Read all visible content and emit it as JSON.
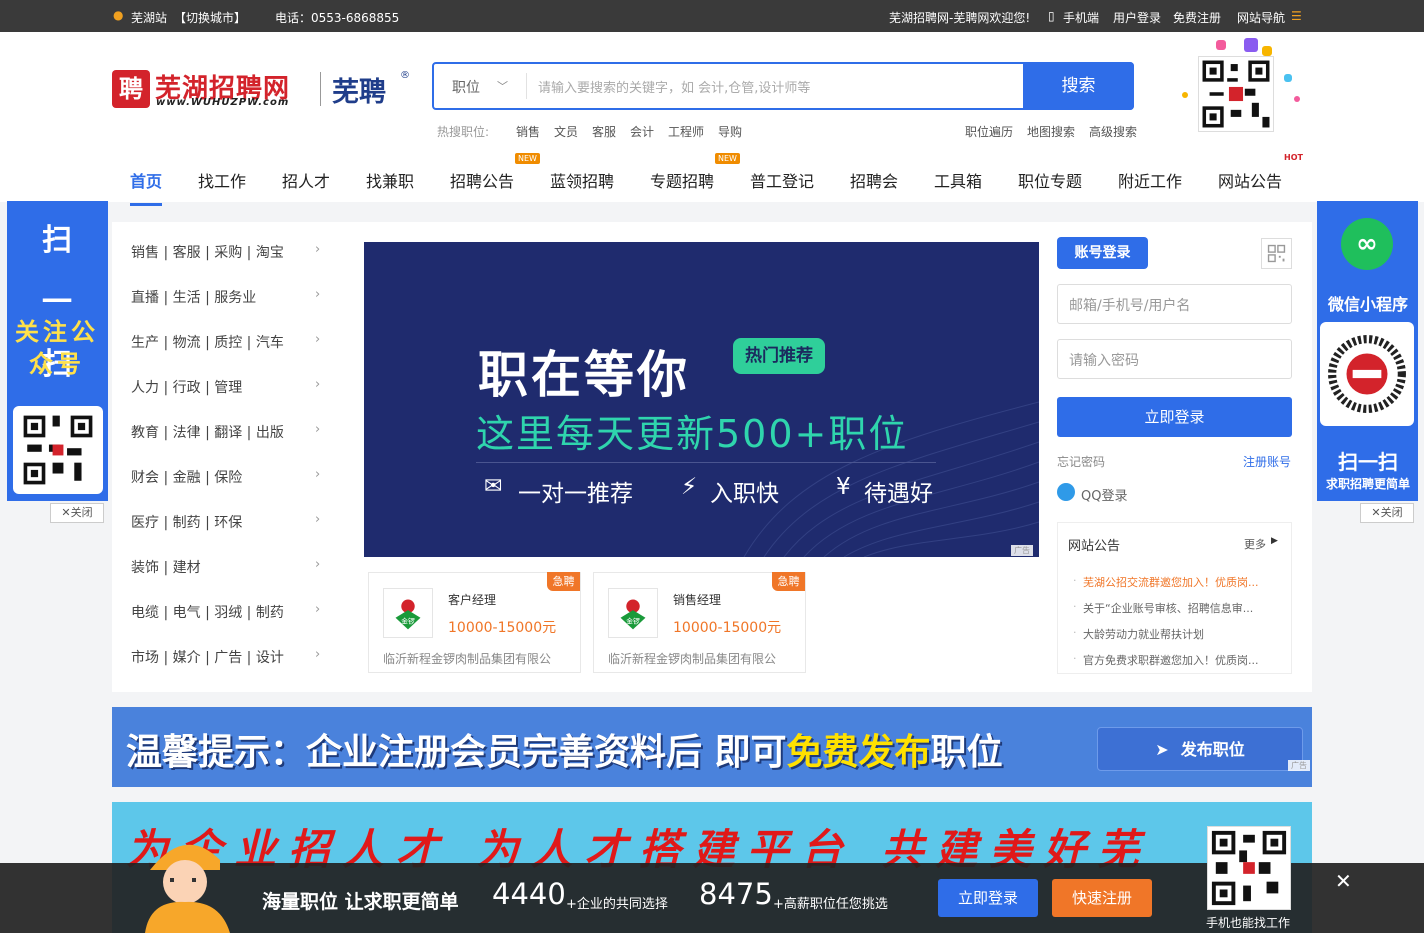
{
  "topbar": {
    "city": "芜湖站",
    "switch_city": "【切换城市】",
    "phone": "电话：0553-6868855",
    "welcome": "芜湖招聘网-芜聘网欢迎您!",
    "mobile": "手机端",
    "user_login": "用户登录",
    "free_register": "免费注册",
    "site_nav": "网站导航"
  },
  "logo": {
    "mark": "聘",
    "cn_name": "芜湖招聘网",
    "url_text": "www.WUHUZPW.com",
    "short_name": "芜聘"
  },
  "search": {
    "type": "职位",
    "placeholder": "请输入要搜索的关键字，如 会计,仓管,设计师等",
    "button": "搜索",
    "hot_label": "热搜职位:",
    "hot_terms": [
      "销售",
      "文员",
      "客服",
      "会计",
      "工程师",
      "导购"
    ],
    "links": [
      "职位遍历",
      "地图搜索",
      "高级搜索"
    ]
  },
  "nav": {
    "items": [
      "首页",
      "找工作",
      "招人才",
      "找兼职",
      "招聘公告",
      "蓝领招聘",
      "专题招聘",
      "普工登记",
      "招聘会",
      "工具箱",
      "职位专题",
      "附近工作",
      "网站公告"
    ],
    "new_badge": "NEW",
    "hot_badge": "HOT"
  },
  "categories": [
    "销售 | 客服 | 采购 | 淘宝",
    "直播 | 生活 | 服务业",
    "生产 | 物流 | 质控 | 汽车",
    "人力 | 行政 | 管理",
    "教育 | 法律 | 翻译 | 出版",
    "财会 | 金融 | 保险",
    "医疗 | 制药 | 环保",
    "装饰 | 建材",
    "电缆 | 电气 | 羽绒 | 制药",
    "市场 | 媒介 | 广告 | 设计"
  ],
  "banner": {
    "title": "职在等你",
    "tag": "热门推荐",
    "subtitle": "这里每天更新500+职位",
    "features": [
      "一对一推荐",
      "入职快",
      "待遇好"
    ],
    "ad_label": "广告"
  },
  "jobs": [
    {
      "title": "客户经理",
      "salary": "10000-15000元",
      "company": "临沂新程金锣肉制品集团有限公",
      "urgent": "急聘"
    },
    {
      "title": "销售经理",
      "salary": "10000-15000元",
      "company": "临沂新程金锣肉制品集团有限公",
      "urgent": "急聘"
    }
  ],
  "login": {
    "tab": "账号登录",
    "username_placeholder": "邮箱/手机号/用户名",
    "password_placeholder": "请输入密码",
    "button": "立即登录",
    "forgot": "忘记密码",
    "register": "注册账号",
    "qq": "QQ登录"
  },
  "notices": {
    "title": "网站公告",
    "more": "更多",
    "items": [
      "芜湖公招交流群邀您加入！优质岗...",
      "关于“企业账号审核、招聘信息审...",
      "大龄劳动力就业帮扶计划",
      "官方免费求职群邀您加入！优质岗..."
    ]
  },
  "side_left": {
    "scan": "扫一扫",
    "follow": "关注公众号",
    "close": "关闭"
  },
  "side_right": {
    "title": "微信小程序",
    "scan": "扫一扫",
    "caption": "求职招聘更简单",
    "close": "关闭"
  },
  "tip_banner": {
    "prefix": "温馨提示：企业注册会员完善资料后 即可",
    "highlight": "免费发布",
    "suffix": "职位",
    "button": "发布职位",
    "ad_label": "广告"
  },
  "promo": {
    "text": "为企业招人才 为人才搭建平台 共建美好芜"
  },
  "bottom_bar": {
    "slogan": "海量职位 让求职更简单",
    "companies_count": "4440",
    "companies_caption": "+企业的共同选择",
    "jobs_count": "8475",
    "jobs_caption": "+高薪职位任您挑选",
    "login": "立即登录",
    "register": "快速注册",
    "qr_caption": "手机也能找工作"
  },
  "colors": {
    "primary": "#2f6de8",
    "brand_red": "#d3232b",
    "orange": "#f07628"
  }
}
